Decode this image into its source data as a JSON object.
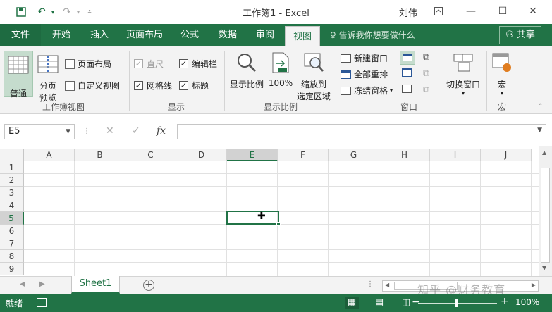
{
  "titlebar": {
    "title": "工作簿1  -  Excel",
    "user": "刘伟"
  },
  "tabs": {
    "file": "文件",
    "items": [
      "开始",
      "插入",
      "页面布局",
      "公式",
      "数据",
      "审阅",
      "视图"
    ],
    "active": "视图",
    "tell_me": "告诉我你想要做什么",
    "share": "共享"
  },
  "ribbon": {
    "workbook_views": {
      "normal": "普通",
      "page_break_1": "分页",
      "page_break_2": "预览",
      "page_layout": "页面布局",
      "custom_views": "自定义视图",
      "group_label": "工作簿视图"
    },
    "show": {
      "ruler": "直尺",
      "formula_bar": "编辑栏",
      "gridlines": "网格线",
      "headings": "标题",
      "group_label": "显示"
    },
    "zoom": {
      "zoom": "显示比例",
      "zoom100": "100%",
      "zoom_sel_1": "缩放到",
      "zoom_sel_2": "选定区域",
      "group_label": "显示比例"
    },
    "window": {
      "new_window": "新建窗口",
      "arrange_all": "全部重排",
      "freeze_panes": "冻结窗格",
      "switch_windows": "切换窗口",
      "group_label": "窗口"
    },
    "macros": {
      "macros": "宏",
      "group_label": "宏"
    }
  },
  "formula_bar": {
    "name_box": "E5",
    "formula": ""
  },
  "grid": {
    "columns": [
      "A",
      "B",
      "C",
      "D",
      "E",
      "F",
      "G",
      "H",
      "I",
      "J"
    ],
    "rows": [
      "1",
      "2",
      "3",
      "4",
      "5",
      "6",
      "7",
      "8",
      "9"
    ],
    "selected_column": "E",
    "selected_row": "5"
  },
  "sheets": {
    "tabs": [
      "Sheet1"
    ],
    "active": "Sheet1"
  },
  "statusbar": {
    "ready": "就绪",
    "zoom": "100%"
  },
  "watermark": "知乎 @财务教育",
  "colors": {
    "accent": "#217346",
    "ribbon_bg": "#f3f3f3"
  }
}
